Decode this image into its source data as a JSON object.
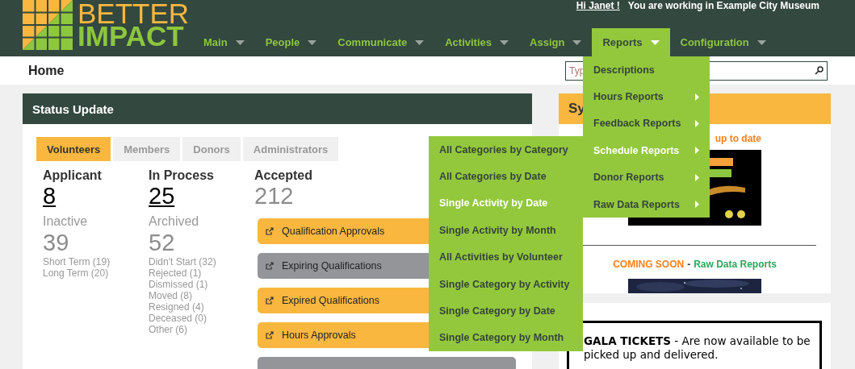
{
  "header": {
    "logo": {
      "line_1": "BETTER",
      "line_2": "IMPACT"
    },
    "greeting": "Hi Janet !",
    "context": "You are working in Example City Museum",
    "nav": [
      {
        "label": "Main",
        "selected": false
      },
      {
        "label": "People",
        "selected": false
      },
      {
        "label": "Communicate",
        "selected": false
      },
      {
        "label": "Activities",
        "selected": false
      },
      {
        "label": "Assign",
        "selected": false
      },
      {
        "label": "Reports",
        "selected": true
      },
      {
        "label": "Configuration",
        "selected": false
      }
    ]
  },
  "page_title": "Home",
  "search": {
    "placeholder": "Typ"
  },
  "status_update": {
    "title": "Status Update",
    "tabs": [
      {
        "label": "Volunteers",
        "selected": true
      },
      {
        "label": "Members",
        "selected": false
      },
      {
        "label": "Donors",
        "selected": false
      },
      {
        "label": "Administrators",
        "selected": false
      }
    ],
    "columns": [
      {
        "heading": "Applicant",
        "count": "8",
        "linked": true,
        "sub_heading": "Inactive",
        "sub_count": "39",
        "details": [
          "Short Term (19)",
          "Long Term (20)"
        ]
      },
      {
        "heading": "In Process",
        "count": "25",
        "linked": true,
        "sub_heading": "Archived",
        "sub_count": "52",
        "details": [
          "Didn't Start (32)",
          "Rejected (1)",
          "Dismissed (1)",
          "Moved (8)",
          "Resigned (4)",
          "Deceased (0)",
          "Other (6)"
        ]
      },
      {
        "heading": "Accepted",
        "count": "212",
        "linked": false
      }
    ],
    "actions": [
      {
        "label": "Qualification Approvals",
        "color": "#f9b73f"
      },
      {
        "label": "Expiring Qualifications",
        "color": "#939598"
      },
      {
        "label": "Expired Qualifications",
        "color": "#f9b73f"
      },
      {
        "label": "Hours Approvals",
        "color": "#f9b73f"
      },
      {
        "color": "#939598"
      }
    ]
  },
  "side_panel": {
    "title": "Sy",
    "notice": "up to date",
    "coming_soon": "COMING SOON",
    "separator": "-",
    "coming_soon_link": "Raw Data Reports"
  },
  "announcement": "**GALA TICKETS** - Are now available to be picked up and delivered.",
  "reports_menu": [
    {
      "label": "Descriptions",
      "has_submenu": false,
      "selected": false
    },
    {
      "label": "Hours Reports",
      "has_submenu": true,
      "selected": false
    },
    {
      "label": "Feedback Reports",
      "has_submenu": true,
      "selected": false
    },
    {
      "label": "Schedule Reports",
      "has_submenu": true,
      "selected": true
    },
    {
      "label": "Donor Reports",
      "has_submenu": true,
      "selected": false
    },
    {
      "label": "Raw Data Reports",
      "has_submenu": true,
      "selected": false
    }
  ],
  "schedule_submenu": [
    {
      "label": "All Categories by Category",
      "selected": false
    },
    {
      "label": "All Categories by Date",
      "selected": false
    },
    {
      "label": "Single Activity by Date",
      "selected": true
    },
    {
      "label": "Single Activity by Month",
      "selected": false
    },
    {
      "label": "All Activities by Volunteer",
      "selected": false
    },
    {
      "label": "Single Category by Activity",
      "selected": false
    },
    {
      "label": "Single Category by Date",
      "selected": false
    },
    {
      "label": "Single Category by Month",
      "selected": false
    }
  ]
}
